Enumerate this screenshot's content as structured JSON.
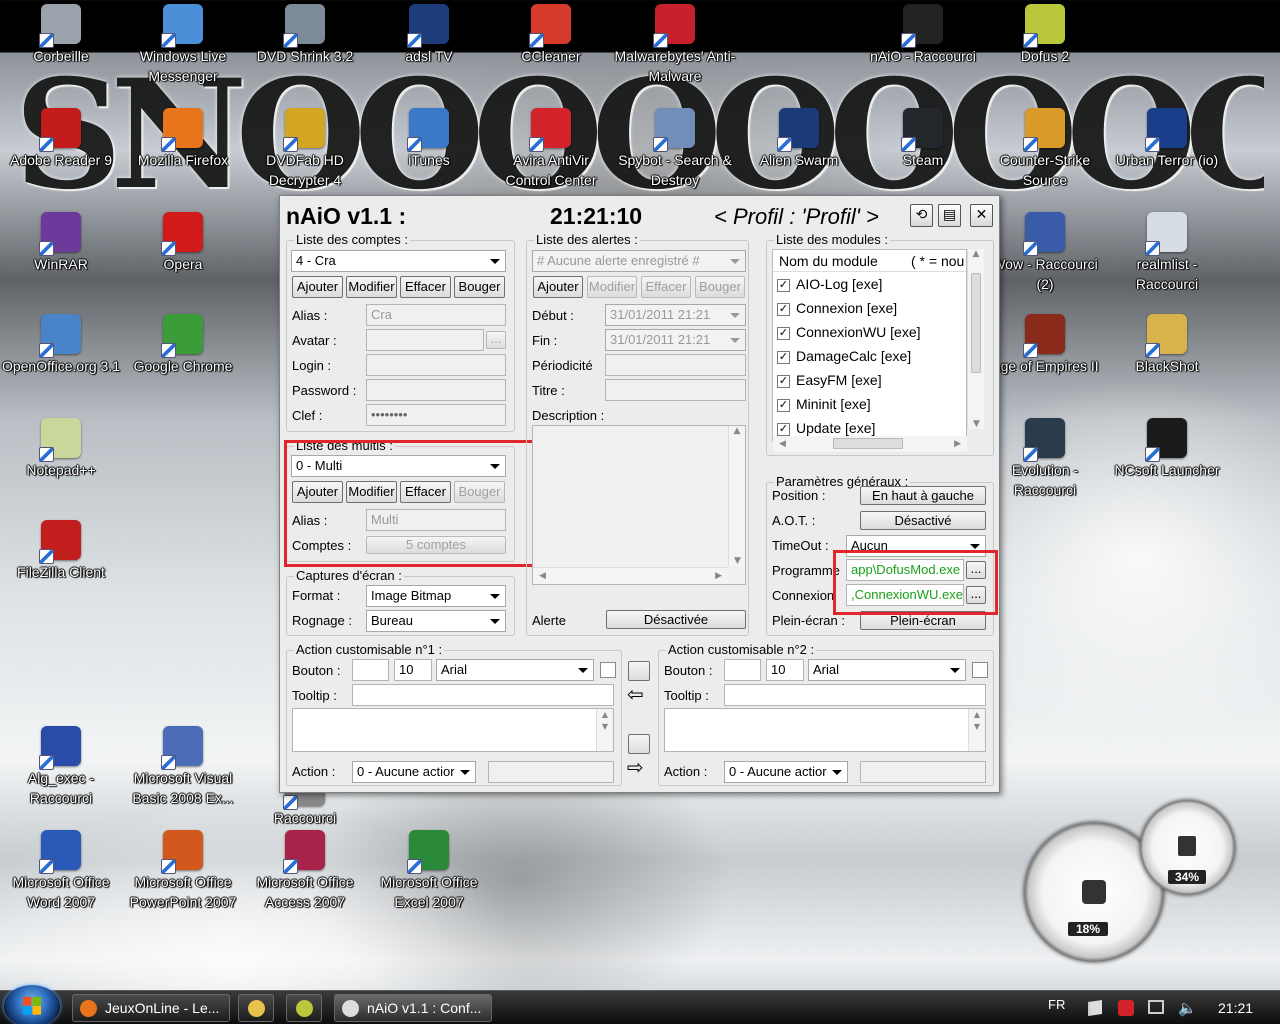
{
  "desktop": {
    "banner_text": "SNOOOOOOOOOOW!",
    "icons": [
      {
        "label": "Corbeille",
        "icon": "recycle-bin-icon",
        "color": "#9aa3ad"
      },
      {
        "label": "Windows Live Messenger",
        "icon": "messenger-icon",
        "color": "#4a8fd8"
      },
      {
        "label": "DVD Shrink 3.2",
        "icon": "dvd-shrink-icon",
        "color": "#7c8a99"
      },
      {
        "label": "adsl TV",
        "icon": "adsl-tv-icon",
        "color": "#1d3d7a"
      },
      {
        "label": "CCleaner",
        "icon": "ccleaner-icon",
        "color": "#d63a2a"
      },
      {
        "label": "Malwarebytes' Anti-Malware",
        "icon": "malwarebytes-icon",
        "color": "#c8202a"
      },
      {
        "label": "nAiO - Raccourci",
        "icon": "naio-icon",
        "color": "#222"
      },
      {
        "label": "Dofus 2",
        "icon": "dofus-icon",
        "color": "#b9c83a"
      },
      {
        "label": "Adobe Reader 9",
        "icon": "adobe-reader-icon",
        "color": "#c41b1b"
      },
      {
        "label": "Mozilla Firefox",
        "icon": "firefox-icon",
        "color": "#e8741c"
      },
      {
        "label": "DVDFab HD Decrypter 4",
        "icon": "dvdfab-icon",
        "color": "#d2a522"
      },
      {
        "label": "iTunes",
        "icon": "itunes-icon",
        "color": "#3a78c8"
      },
      {
        "label": "Avira AntiVir Control Center",
        "icon": "avira-icon",
        "color": "#d3232a"
      },
      {
        "label": "Spybot - Search & Destroy",
        "icon": "spybot-icon",
        "color": "#6f8fb8"
      },
      {
        "label": "Alien Swarm",
        "icon": "alien-swarm-icon",
        "color": "#1b3a78"
      },
      {
        "label": "Steam",
        "icon": "steam-icon",
        "color": "#23262b"
      },
      {
        "label": "Counter-Strike Source",
        "icon": "counter-strike-icon",
        "color": "#d89b2a"
      },
      {
        "label": "Urban Terror (io)",
        "icon": "urban-terror-icon",
        "color": "#1a3f8a"
      },
      {
        "label": "WinRAR",
        "icon": "winrar-icon",
        "color": "#6c3a9a"
      },
      {
        "label": "Opera",
        "icon": "opera-icon",
        "color": "#d11a1a"
      },
      {
        "label": "Wow - Raccourci (2)",
        "icon": "wow-icon",
        "color": "#3a5ca8"
      },
      {
        "label": "realmlist - Raccourci",
        "icon": "realmlist-icon",
        "color": "#d7dde5"
      },
      {
        "label": "OpenOffice.org 3.1",
        "icon": "openoffice-icon",
        "color": "#4a84c8"
      },
      {
        "label": "Google Chrome",
        "icon": "chrome-icon",
        "color": "#3a9d3a"
      },
      {
        "label": "Age of Empires II",
        "icon": "age-of-empires-icon",
        "color": "#8a2a1a"
      },
      {
        "label": "BlackShot",
        "icon": "blackshot-icon",
        "color": "#d8b24a"
      },
      {
        "label": "Notepad++",
        "icon": "notepadpp-icon",
        "color": "#c9d89a"
      },
      {
        "label": "Evolution - Raccourci",
        "icon": "evolution-icon",
        "color": "#2a3b4c"
      },
      {
        "label": "NCsoft Launcher",
        "icon": "ncsoft-icon",
        "color": "#1b1b1b"
      },
      {
        "label": "FileZilla Client",
        "icon": "filezilla-icon",
        "color": "#c21e1e"
      },
      {
        "label": "Alg_exec - Raccourci",
        "icon": "alg-exec-icon",
        "color": "#2a4ca8"
      },
      {
        "label": "Microsoft Visual Basic 2008 Ex...",
        "icon": "visual-basic-icon",
        "color": "#4b6db8"
      },
      {
        "label": "Raccourci",
        "icon": "shortcut-icon",
        "color": "#888"
      },
      {
        "label": "Microsoft Office Word 2007",
        "icon": "word-icon",
        "color": "#2a5ab8"
      },
      {
        "label": "Microsoft Office PowerPoint 2007",
        "icon": "powerpoint-icon",
        "color": "#d2581e"
      },
      {
        "label": "Microsoft Office Access 2007",
        "icon": "access-icon",
        "color": "#a8234a"
      },
      {
        "label": "Microsoft Office Excel 2007",
        "icon": "excel-icon",
        "color": "#2a8a3a"
      }
    ]
  },
  "window": {
    "app_name": "nAiO v1.1 :",
    "clock": "21:21:10",
    "profile": "< Profil : 'Profil' >",
    "comptes": {
      "title": "Liste des comptes :",
      "selected": "4 - Cra",
      "buttons": [
        "Ajouter",
        "Modifier",
        "Effacer",
        "Bouger"
      ],
      "fields": [
        {
          "label": "Alias :",
          "value": "Cra"
        },
        {
          "label": "Avatar :",
          "value": ""
        },
        {
          "label": "Login :",
          "value": ""
        },
        {
          "label": "Password :",
          "value": ""
        },
        {
          "label": "Clef :",
          "value": "••••••••"
        }
      ],
      "browse": "..."
    },
    "multis": {
      "title": "Liste des multis :",
      "selected": "0 - Multi",
      "buttons": [
        "Ajouter",
        "Modifier",
        "Effacer",
        "Bouger"
      ],
      "alias_label": "Alias :",
      "alias_value": "Multi",
      "comptes_label": "Comptes :",
      "comptes_value": "5 comptes"
    },
    "captures": {
      "title": "Captures d'écran :",
      "format_label": "Format :",
      "format_value": "Image Bitmap",
      "rognage_label": "Rognage :",
      "rognage_value": "Bureau"
    },
    "alertes": {
      "title": "Liste des alertes :",
      "selected": "# Aucune alerte enregistré #",
      "buttons": [
        "Ajouter",
        "Modifier",
        "Effacer",
        "Bouger"
      ],
      "debut_label": "Début :",
      "debut_value": "31/01/2011 21:21",
      "fin_label": "Fin :",
      "fin_value": "31/01/2011 21:21",
      "periodicite_label": "Périodicité",
      "titre_label": "Titre :",
      "description_label": "Description :",
      "alerte_label": "Alerte",
      "alerte_button": "Désactivée"
    },
    "modules": {
      "title": "Liste des modules :",
      "col1": "Nom du module",
      "col2": "( * = nou",
      "items": [
        "AIO-Log [exe]",
        "Connexion [exe]",
        "ConnexionWU [exe]",
        "DamageCalc [exe]",
        "EasyFM [exe]",
        "Mininit [exe]",
        "Update [exe]"
      ]
    },
    "params": {
      "title": "Paramètres généraux :",
      "position_label": "Position :",
      "position_value": "En haut à gauche",
      "aot_label": "A.O.T. :",
      "aot_value": "Désactivé",
      "timeout_label": "TimeOut :",
      "timeout_value": "Aucun",
      "programme_label": "Programme",
      "programme_value": "app\\DofusMod.exe",
      "connexion_label": "Connexion",
      "connexion_value": ",ConnexionWU.exe",
      "pleinecran_label": "Plein-écran :",
      "pleinecran_value": "Plein-écran",
      "browse": "..."
    },
    "action1": {
      "title": "Action customisable n°1 :",
      "bouton_label": "Bouton :",
      "size": "10",
      "font": "Arial",
      "tooltip_label": "Tooltip :",
      "action_label": "Action :",
      "action_value": "0 - Aucune actior"
    },
    "action2": {
      "title": "Action customisable n°2 :",
      "bouton_label": "Bouton :",
      "size": "10",
      "font": "Arial",
      "tooltip_label": "Tooltip :",
      "action_label": "Action :",
      "action_value": "0 - Aucune actior"
    },
    "arrows": {
      "left": "⇦",
      "right": "⇨"
    }
  },
  "gadgets": {
    "cpu": "18%",
    "mem": "34%"
  },
  "taskbar": {
    "tasks": [
      {
        "label": "JeuxOnLine - Le...",
        "icon": "firefox-icon",
        "color": "#e8741c"
      },
      {
        "label": "",
        "icon": "explorer-icon",
        "color": "#e8c24a"
      },
      {
        "label": "",
        "icon": "dofus-icon",
        "color": "#b9c83a"
      },
      {
        "label": "nAiO v1.1 : Conf...",
        "icon": "naio-icon",
        "color": "#ddd"
      }
    ],
    "lang": "FR",
    "time": "21:21"
  },
  "colors": {
    "highlight": "#e0252b",
    "path_text": "#19a019"
  }
}
